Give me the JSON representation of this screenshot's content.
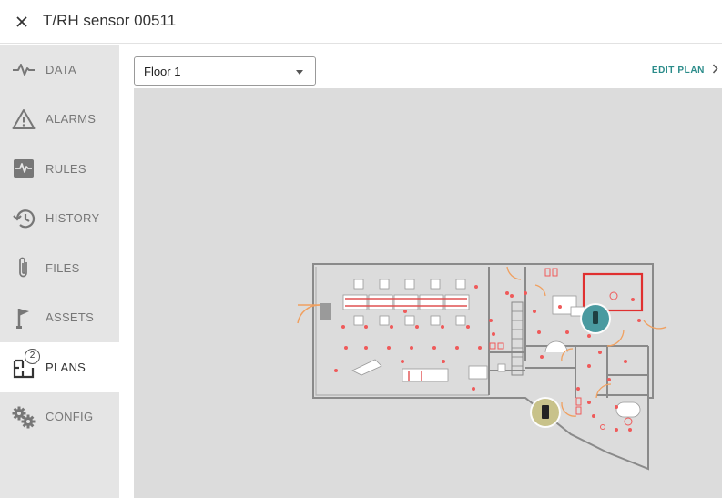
{
  "header": {
    "title": "T/RH sensor 00511",
    "close_icon": "close-icon"
  },
  "sidebar": {
    "items": [
      {
        "key": "data",
        "label": "DATA",
        "icon": "pulse-icon",
        "active": false
      },
      {
        "key": "alarms",
        "label": "ALARMS",
        "icon": "warning-triangle-icon",
        "active": false
      },
      {
        "key": "rules",
        "label": "RULES",
        "icon": "rules-pulse-box-icon",
        "active": false
      },
      {
        "key": "history",
        "label": "HISTORY",
        "icon": "history-icon",
        "active": false
      },
      {
        "key": "files",
        "label": "FILES",
        "icon": "paperclip-icon",
        "active": false
      },
      {
        "key": "assets",
        "label": "ASSETS",
        "icon": "flag-icon",
        "active": false
      },
      {
        "key": "plans",
        "label": "PLANS",
        "icon": "floor-plan-icon",
        "active": true,
        "badge": "2"
      },
      {
        "key": "config",
        "label": "CONFIG",
        "icon": "gears-icon",
        "active": false
      }
    ]
  },
  "main": {
    "floor_select": {
      "value": "Floor 1"
    },
    "edit_plan_label": "EDIT PLAN",
    "accent_color": "#2b8c8a",
    "plan": {
      "markers": [
        {
          "name": "sensor-marker-teal",
          "color": "#4a9aa0"
        },
        {
          "name": "sensor-marker-olive",
          "color": "#c8c28a"
        }
      ]
    }
  }
}
